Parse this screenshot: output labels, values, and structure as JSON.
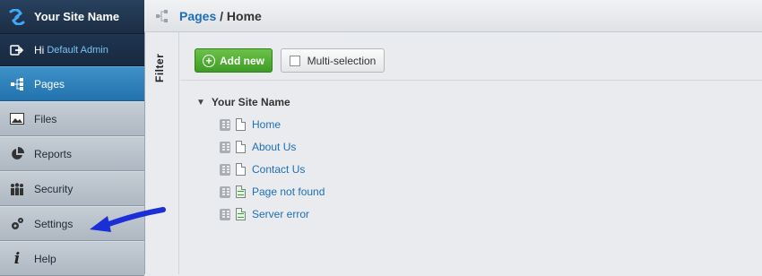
{
  "brand": {
    "name": "Your Site Name"
  },
  "greeting": {
    "prefix": "Hi",
    "user": "Default Admin"
  },
  "sidebar": {
    "items": [
      {
        "label": "Pages",
        "icon": "sitemap-icon",
        "active": true
      },
      {
        "label": "Files",
        "icon": "image-icon"
      },
      {
        "label": "Reports",
        "icon": "pie-chart-icon"
      },
      {
        "label": "Security",
        "icon": "users-icon"
      },
      {
        "label": "Settings",
        "icon": "gears-icon"
      },
      {
        "label": "Help",
        "icon": "info-icon"
      }
    ]
  },
  "filter": {
    "label": "Filter"
  },
  "breadcrumb": {
    "section": "Pages",
    "separator": "/",
    "current": "Home"
  },
  "toolbar": {
    "add_label": "Add new",
    "multi_label": "Multi-selection"
  },
  "tree": {
    "root": "Your Site Name",
    "pages": [
      {
        "label": "Home",
        "type": "page"
      },
      {
        "label": "About Us",
        "type": "page"
      },
      {
        "label": "Contact Us",
        "type": "page"
      },
      {
        "label": "Page not found",
        "type": "error-page"
      },
      {
        "label": "Server error",
        "type": "error-page"
      }
    ]
  },
  "colors": {
    "accent": "#2273ad",
    "link": "#1e6fb5",
    "add_button": "#4caf2f",
    "annotation_arrow": "#1a2fd6"
  }
}
